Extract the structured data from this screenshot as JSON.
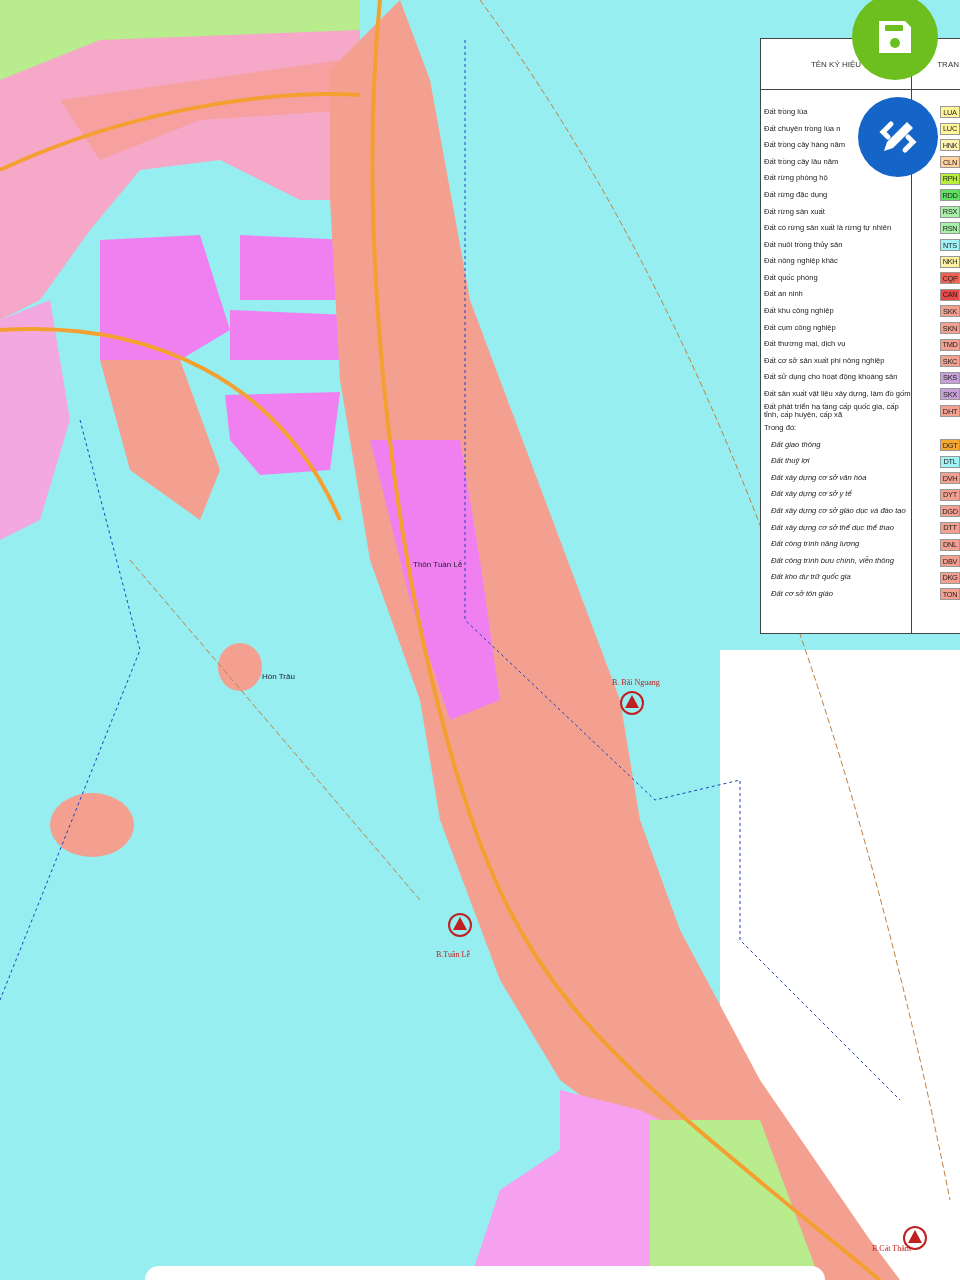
{
  "legend": {
    "header": "TÊN KÝ HIỆU",
    "header_2": "TRAN",
    "rows": [
      {
        "kind": "item",
        "label": "Đất trồng lúa",
        "code": "LUA",
        "color": "#fff59a"
      },
      {
        "kind": "item",
        "label": "Đất chuyên trồng lúa n",
        "code": "LUC",
        "color": "#fff59a"
      },
      {
        "kind": "item",
        "label": "Đất trồng cây hàng năm",
        "code": "HNK",
        "color": "#fff3b0"
      },
      {
        "kind": "item",
        "label": "Đất trồng cây lâu năm",
        "code": "CLN",
        "color": "#ffd0a0"
      },
      {
        "kind": "item",
        "label": "Đất rừng phòng hộ",
        "code": "RPH",
        "color": "#b8f040"
      },
      {
        "kind": "item",
        "label": "Đất rừng đặc dụng",
        "code": "RDD",
        "color": "#60e060"
      },
      {
        "kind": "item",
        "label": "Đất rừng sản xuất",
        "code": "RSX",
        "color": "#a8f0a8"
      },
      {
        "kind": "item",
        "label": "Đất có rừng sản xuất là rừng tự nhiên",
        "code": "RSN",
        "color": "#a8f0a8"
      },
      {
        "kind": "item",
        "label": "Đất nuôi trồng thủy sản",
        "code": "NTS",
        "color": "#a0f4f8"
      },
      {
        "kind": "item",
        "label": "Đất nông nghiệp khác",
        "code": "NKH",
        "color": "#fff0a0"
      },
      {
        "kind": "item",
        "label": "Đất quốc phòng",
        "code": "CQP",
        "color": "#f06050"
      },
      {
        "kind": "item",
        "label": "Đất an ninh",
        "code": "CAN",
        "color": "#e84848"
      },
      {
        "kind": "item",
        "label": "Đất khu công nghiệp",
        "code": "SKK",
        "color": "#f4a090"
      },
      {
        "kind": "item",
        "label": "Đất cụm công nghiệp",
        "code": "SKN",
        "color": "#f4a090"
      },
      {
        "kind": "item",
        "label": "Đất thương mại, dịch vụ",
        "code": "TMD",
        "color": "#f4a090"
      },
      {
        "kind": "item",
        "label": "Đất cơ sở sản xuất phi nông nghiệp",
        "code": "SKC",
        "color": "#f4a090"
      },
      {
        "kind": "item",
        "label": "Đất sử dụng cho hoạt động khoáng sản",
        "code": "SKS",
        "color": "#c8a0d8"
      },
      {
        "kind": "item",
        "label": "Đất sản xuất vật liệu xây dựng, làm đồ gốm",
        "code": "SKX",
        "color": "#c8a0d8"
      },
      {
        "kind": "item",
        "label": "Đất phát triển hạ tầng cấp quốc gia, cấp tỉnh, cấp huyện, cấp xã",
        "code": "DHT",
        "color": "#f4a090"
      },
      {
        "kind": "heading",
        "label": "Trong đó:"
      },
      {
        "kind": "sub",
        "label": "Đất giao thông",
        "code": "DGT",
        "color": "#f8a830"
      },
      {
        "kind": "sub",
        "label": "Đất thuỷ lợi",
        "code": "DTL",
        "color": "#a0f4f8"
      },
      {
        "kind": "sub",
        "label": "Đất xây dựng cơ sở văn hóa",
        "code": "DVH",
        "color": "#f4a090"
      },
      {
        "kind": "sub",
        "label": "Đất xây dựng cơ sở y tế",
        "code": "DYT",
        "color": "#f4a090"
      },
      {
        "kind": "sub",
        "label": "Đất xây dựng cơ sở giáo dục và đào tạo",
        "code": "DGD",
        "color": "#f4a090"
      },
      {
        "kind": "sub",
        "label": "Đất xây dựng cơ sở thể dục thể thao",
        "code": "DTT",
        "color": "#f4a090"
      },
      {
        "kind": "sub",
        "label": "Đất công trình năng lượng",
        "code": "DNL",
        "color": "#f4a090"
      },
      {
        "kind": "sub",
        "label": "Đất công trình bưu chính, viễn  thông",
        "code": "DBV",
        "color": "#f4a090"
      },
      {
        "kind": "sub",
        "label": "Đất kho dự trữ quốc gia",
        "code": "DKG",
        "color": "#f4a090"
      },
      {
        "kind": "sub",
        "label": "Đất cơ sở  tôn giáo",
        "code": "TON",
        "color": "#f4a090"
      }
    ]
  },
  "map_labels": [
    {
      "kind": "place",
      "text": "Thôn Tuần Lễ"
    },
    {
      "kind": "place",
      "text": "Hòn Trâu"
    },
    {
      "kind": "beacon",
      "text": "B. Bãi Nguang"
    },
    {
      "kind": "beacon",
      "text": "B.Tuần Lễ"
    },
    {
      "kind": "beacon",
      "text": "B.Cát Thắm"
    }
  ]
}
